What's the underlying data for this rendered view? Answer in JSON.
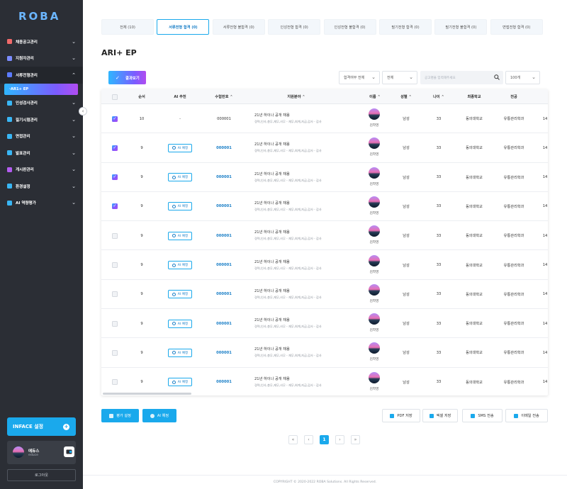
{
  "app": {
    "logo": "ROBA"
  },
  "sidebar": {
    "items": [
      {
        "label": "채용공고관리",
        "icon": "recruit-icon",
        "color": "#f06a6a"
      },
      {
        "label": "지원자관리",
        "icon": "applicant-icon",
        "color": "#7b8cff"
      },
      {
        "label": "서류전형관리",
        "icon": "document-icon",
        "color": "#5b7bff",
        "expanded": true
      },
      {
        "label": "인성검사관리",
        "icon": "personality-icon",
        "color": "#39b6f5"
      },
      {
        "label": "필기시험관리",
        "icon": "exam-icon",
        "color": "#39b6f5"
      },
      {
        "label": "면접관리",
        "icon": "interview-icon",
        "color": "#39b6f5"
      },
      {
        "label": "발표관리",
        "icon": "announce-icon",
        "color": "#39b6f5"
      },
      {
        "label": "게시판관리",
        "icon": "board-icon",
        "color": "#b35cf0"
      },
      {
        "label": "환경설정",
        "icon": "settings-icon",
        "color": "#39b6f5"
      },
      {
        "label": "AI 역량평가",
        "icon": "ai-eval-icon",
        "color": "#39b6f5"
      }
    ],
    "sub_item": "AR1+ EP",
    "inface_button": "INFACE 설정",
    "user": {
      "name": "에듀스",
      "id": "educe"
    },
    "logout": "로그아웃"
  },
  "tabs": [
    {
      "label": "전체 (10)",
      "active": false
    },
    {
      "label": "서류전형 합격 (0)",
      "active": true
    },
    {
      "label": "서류전형 불합격 (0)",
      "active": false
    },
    {
      "label": "인성전형 합격 (0)",
      "active": false
    },
    {
      "label": "인성전형 불합격 (0)",
      "active": false
    },
    {
      "label": "필기전형 합격 (0)",
      "active": false
    },
    {
      "label": "필기전형 불합격 (0)",
      "active": false
    },
    {
      "label": "면접전형 합격 (0)",
      "active": false
    }
  ],
  "page_title": "ARI+ EP",
  "toolbar": {
    "filter_button": "결과보기",
    "select_pass": "합격여부 전체",
    "select_all": "전체",
    "search_placeholder": "공고명을 입력해주세요",
    "page_size": "100개"
  },
  "table": {
    "headers": [
      "순서",
      "AI 추천",
      "수험번호",
      "지원분야",
      "이름",
      "성별",
      "나이",
      "최종학교",
      "전공"
    ],
    "rows": [
      {
        "checked": true,
        "order": "10",
        "ai": "-",
        "receipt": "000001",
        "field": "21년 하이나 공개 채용",
        "field_sub": "경력,인사,총무,재무,사무 - 재무,회계,자금,감사 - 감사",
        "name": "김학영",
        "gender": "남성",
        "age": "33",
        "school": "동의대학교",
        "major": "유통관리학과",
        "extra": "14"
      },
      {
        "checked": true,
        "order": "9",
        "ai": "AI 예정",
        "receipt": "000001",
        "field": "21년 하이나 공개 채용",
        "field_sub": "경력,인사,총무,재무,사무 - 재무,회계,자금,감사 - 감사",
        "name": "김학영",
        "gender": "남성",
        "age": "33",
        "school": "동의대학교",
        "major": "유통관리학과",
        "extra": "14"
      },
      {
        "checked": true,
        "order": "9",
        "ai": "AI 예정",
        "receipt": "000001",
        "field": "21년 하이나 공개 채용",
        "field_sub": "경력,인사,총무,재무,사무 - 재무,회계,자금,감사 - 감사",
        "name": "김학영",
        "gender": "남성",
        "age": "33",
        "school": "동의대학교",
        "major": "유통관리학과",
        "extra": "14"
      },
      {
        "checked": true,
        "order": "9",
        "ai": "AI 예정",
        "receipt": "000001",
        "field": "21년 하이나 공개 채용",
        "field_sub": "경력,인사,총무,재무,사무 - 재무,회계,자금,감사 - 감사",
        "name": "김학영",
        "gender": "남성",
        "age": "33",
        "school": "동의대학교",
        "major": "유통관리학과",
        "extra": "14"
      },
      {
        "checked": false,
        "order": "9",
        "ai": "AI 예정",
        "receipt": "000001",
        "field": "21년 하이나 공개 채용",
        "field_sub": "경력,인사,총무,재무,사무 - 재무,회계,자금,감사 - 감사",
        "name": "김학영",
        "gender": "남성",
        "age": "33",
        "school": "동의대학교",
        "major": "유통관리학과",
        "extra": "14"
      },
      {
        "checked": false,
        "order": "9",
        "ai": "AI 예정",
        "receipt": "000001",
        "field": "21년 하이나 공개 채용",
        "field_sub": "경력,인사,총무,재무,사무 - 재무,회계,자금,감사 - 감사",
        "name": "김학영",
        "gender": "남성",
        "age": "33",
        "school": "동의대학교",
        "major": "유통관리학과",
        "extra": "14"
      },
      {
        "checked": false,
        "order": "9",
        "ai": "AI 예정",
        "receipt": "000001",
        "field": "21년 하이나 공개 채용",
        "field_sub": "경력,인사,총무,재무,사무 - 재무,회계,자금,감사 - 감사",
        "name": "김학영",
        "gender": "남성",
        "age": "33",
        "school": "동의대학교",
        "major": "유통관리학과",
        "extra": "14"
      },
      {
        "checked": false,
        "order": "9",
        "ai": "AI 예정",
        "receipt": "000001",
        "field": "21년 하이나 공개 채용",
        "field_sub": "경력,인사,총무,재무,사무 - 재무,회계,자금,감사 - 감사",
        "name": "김학영",
        "gender": "남성",
        "age": "33",
        "school": "동의대학교",
        "major": "유통관리학과",
        "extra": "14"
      },
      {
        "checked": false,
        "order": "9",
        "ai": "AI 예정",
        "receipt": "000001",
        "field": "21년 하이나 공개 채용",
        "field_sub": "경력,인사,총무,재무,사무 - 재무,회계,자금,감사 - 감사",
        "name": "김학영",
        "gender": "남성",
        "age": "33",
        "school": "동의대학교",
        "major": "유통관리학과",
        "extra": "14"
      },
      {
        "checked": false,
        "order": "9",
        "ai": "AI 예정",
        "receipt": "000001",
        "field": "21년 하이나 공개 채용",
        "field_sub": "경력,인사,총무,재무,사무 - 재무,회계,자금,감사 - 감사",
        "name": "김학영",
        "gender": "남성",
        "age": "33",
        "school": "동의대학교",
        "major": "유통관리학과",
        "extra": "14"
      }
    ]
  },
  "actions": {
    "eval_settings": "평가 설정",
    "ai_eval": "AI 예정",
    "pdf_save": "PDF 저장",
    "excel_save": "엑셀 저장",
    "sms_send": "SMS 전송",
    "email_send": "이메일 전송"
  },
  "pagination": {
    "current": "1"
  },
  "footer": "COPYRIGHT © 2020-2022 ROBA Solutions. All Rights Reserved.",
  "colors": {
    "accent": "#1aa9ec",
    "sidebar_bg": "#2b2e35",
    "gradient_start": "#2fb6ff",
    "gradient_end": "#b14cf0"
  }
}
